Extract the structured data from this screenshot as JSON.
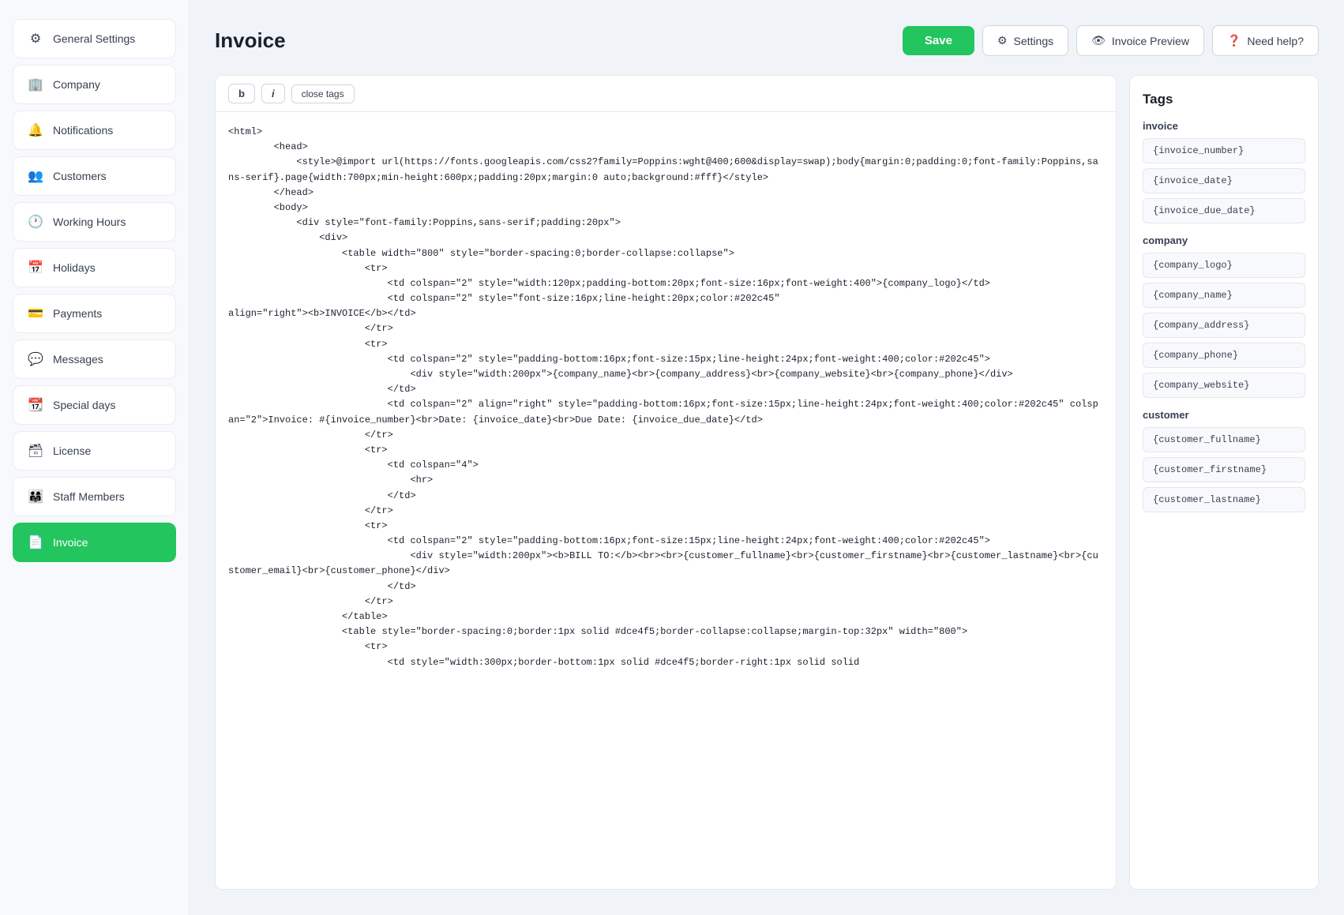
{
  "sidebar": {
    "items": [
      {
        "id": "general-settings",
        "label": "General Settings",
        "icon": "⚙",
        "active": false
      },
      {
        "id": "company",
        "label": "Company",
        "icon": "🏢",
        "active": false
      },
      {
        "id": "notifications",
        "label": "Notifications",
        "icon": "🔔",
        "active": false
      },
      {
        "id": "customers",
        "label": "Customers",
        "icon": "👥",
        "active": false
      },
      {
        "id": "working-hours",
        "label": "Working Hours",
        "icon": "🕐",
        "active": false
      },
      {
        "id": "holidays",
        "label": "Holidays",
        "icon": "📅",
        "active": false
      },
      {
        "id": "payments",
        "label": "Payments",
        "icon": "💳",
        "active": false
      },
      {
        "id": "messages",
        "label": "Messages",
        "icon": "💬",
        "active": false
      },
      {
        "id": "special-days",
        "label": "Special days",
        "icon": "📆",
        "active": false
      },
      {
        "id": "license",
        "label": "License",
        "icon": "🗃",
        "active": false
      },
      {
        "id": "staff-members",
        "label": "Staff Members",
        "icon": "👨‍👩‍👧",
        "active": false
      },
      {
        "id": "invoice",
        "label": "Invoice",
        "icon": "📄",
        "active": true
      }
    ]
  },
  "header": {
    "title": "Invoice",
    "save_label": "Save",
    "settings_label": "Settings",
    "invoice_preview_label": "Invoice Preview",
    "need_help_label": "Need help?"
  },
  "toolbar": {
    "bold_label": "b",
    "italic_label": "i",
    "close_tags_label": "close tags"
  },
  "code_editor": {
    "content": "<html>\n        <head>\n            <style>@import url(https://fonts.googleapis.com/css2?family=Poppins:wght@400;600&display=swap);body{margin:0;padding:0;font-family:Poppins,sans-serif}.page{width:700px;min-height:600px;padding:20px;margin:0 auto;background:#fff}</style>\n        </head>\n        <body>\n            <div style=\"font-family:Poppins,sans-serif;padding:20px\">\n                <div>\n                    <table width=\"800\" style=\"border-spacing:0;border-collapse:collapse\">\n                        <tr>\n                            <td colspan=\"2\" style=\"width:120px;padding-bottom:20px;font-size:16px;font-weight:400\">{company_logo}</td>\n                            <td colspan=\"2\" style=\"font-size:16px;line-height:20px;color:#202c45\"\nalign=\"right\"><b>INVOICE</b></td>\n                        </tr>\n                        <tr>\n                            <td colspan=\"2\" style=\"padding-bottom:16px;font-size:15px;line-height:24px;font-weight:400;color:#202c45\">\n                                <div style=\"width:200px\">{company_name}<br>{company_address}<br>{company_website}<br>{company_phone}</div>\n                            </td>\n                            <td colspan=\"2\" align=\"right\" style=\"padding-bottom:16px;font-size:15px;line-height:24px;font-weight:400;color:#202c45\" colspan=\"2\">Invoice: #{invoice_number}<br>Date: {invoice_date}<br>Due Date: {invoice_due_date}</td>\n                        </tr>\n                        <tr>\n                            <td colspan=\"4\">\n                                <hr>\n                            </td>\n                        </tr>\n                        <tr>\n                            <td colspan=\"2\" style=\"padding-bottom:16px;font-size:15px;line-height:24px;font-weight:400;color:#202c45\">\n                                <div style=\"width:200px\"><b>BILL TO:</b><br><br>{customer_fullname}<br>{customer_firstname}<br>{customer_lastname}<br>{customer_email}<br>{customer_phone}</div>\n                            </td>\n                        </tr>\n                    </table>\n                    <table style=\"border-spacing:0;border:1px solid #dce4f5;border-collapse:collapse;margin-top:32px\" width=\"800\">\n                        <tr>\n                            <td style=\"width:300px;border-bottom:1px solid #dce4f5;border-right:1px solid solid"
  },
  "tags": {
    "title": "Tags",
    "sections": [
      {
        "id": "invoice",
        "title": "invoice",
        "items": [
          "{invoice_number}",
          "{invoice_date}",
          "{invoice_due_date}"
        ]
      },
      {
        "id": "company",
        "title": "company",
        "items": [
          "{company_logo}",
          "{company_name}",
          "{company_address}",
          "{company_phone}",
          "{company_website}"
        ]
      },
      {
        "id": "customer",
        "title": "customer",
        "items": [
          "{customer_fullname}",
          "{customer_firstname}",
          "{customer_lastname}"
        ]
      }
    ]
  }
}
